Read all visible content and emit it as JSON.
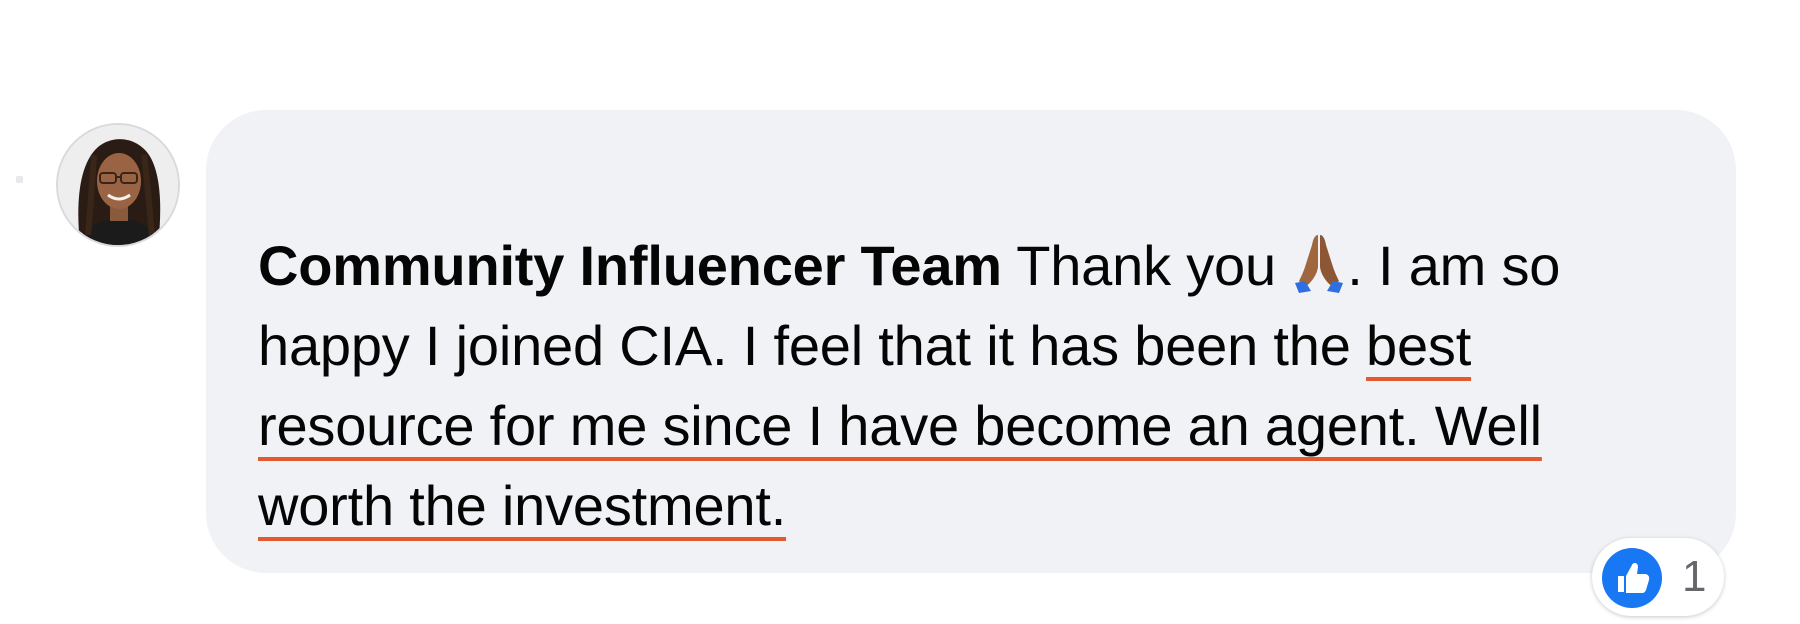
{
  "comment": {
    "author": "Community Influencer Team",
    "text_before_emoji": "Thank you ",
    "emoji": "folded-hands-icon",
    "text_after_emoji": ". I am so happy I joined CIA. I feel that it has been the ",
    "underlined_text": "best resource for me since I have become an agent. Well worth the investment."
  },
  "reactions": {
    "type": "like-icon",
    "count": "1"
  },
  "colors": {
    "bubble": "#f0f2f5",
    "text": "#050505",
    "underline": "#e45a2e",
    "like_blue": "#1877f2",
    "count_gray": "#65676b"
  }
}
